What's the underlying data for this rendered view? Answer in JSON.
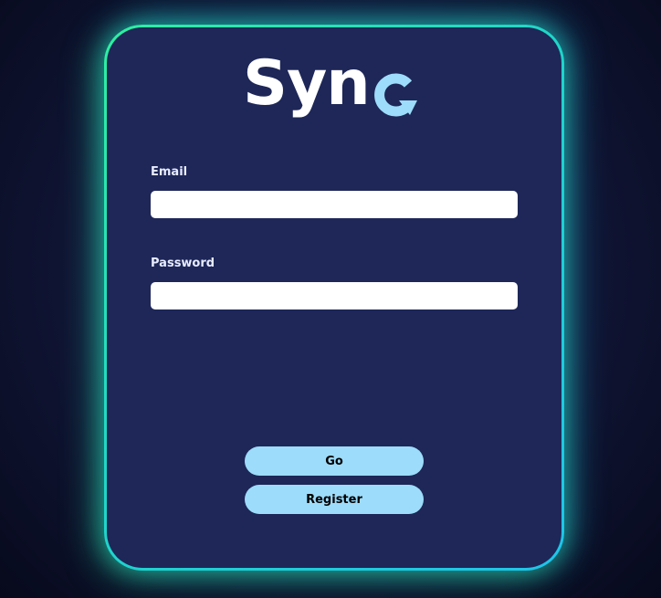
{
  "app": {
    "logo_text": "Syn",
    "logo_icon": "sync-arrow-c-icon",
    "logo_accent_color": "#9ddcfb"
  },
  "form": {
    "email_label": "Email",
    "email_value": "",
    "password_label": "Password",
    "password_value": "",
    "go_label": "Go",
    "register_label": "Register"
  },
  "colors": {
    "card_background": "#1e2758",
    "glow_start": "#2ef0a0",
    "glow_end": "#1ec4ea",
    "button_background": "#9ddcfb"
  }
}
